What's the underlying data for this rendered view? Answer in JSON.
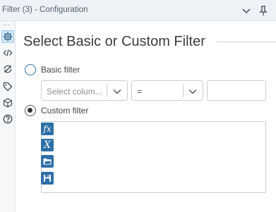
{
  "window": {
    "title": "Filter (3) - Configuration",
    "titlebar_bg": "#eef2f6"
  },
  "sidebar": {
    "dots": "···",
    "items": [
      {
        "name": "gear-icon",
        "active": true
      },
      {
        "name": "code-icon",
        "active": false
      },
      {
        "name": "refresh-icon",
        "active": false
      },
      {
        "name": "tag-icon",
        "active": false
      },
      {
        "name": "cube-icon",
        "active": false
      },
      {
        "name": "help-icon",
        "active": false
      }
    ]
  },
  "main": {
    "heading": "Select Basic or Custom Filter",
    "basic": {
      "label": "Basic filter",
      "selected": false,
      "column_placeholder": "Select colum...",
      "operator": "=",
      "value": ""
    },
    "custom": {
      "label": "Custom filter",
      "selected": true,
      "expression": "",
      "tools": [
        {
          "name": "function-icon",
          "glyph": "fx"
        },
        {
          "name": "variable-icon",
          "glyph": "X"
        },
        {
          "name": "open-folder-icon",
          "glyph": ""
        },
        {
          "name": "save-icon",
          "glyph": ""
        }
      ]
    }
  },
  "colors": {
    "accent": "#2f6fa8",
    "active_tab": "#cfe6f7"
  }
}
